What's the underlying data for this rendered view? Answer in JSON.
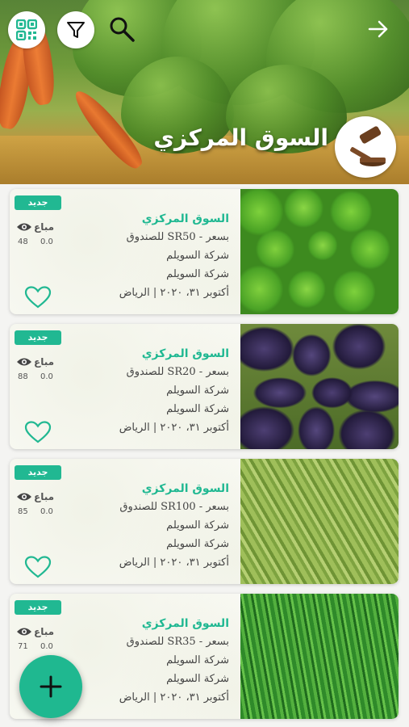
{
  "header": {
    "title": "السوق المركزي",
    "icons": [
      "qr-code-icon",
      "filter-icon",
      "search-icon",
      "arrow-right-icon",
      "auction-gavel-icon"
    ]
  },
  "colors": {
    "accent": "#21b892",
    "title_text": "#ffffff",
    "heart": "#21b892"
  },
  "listings": [
    {
      "badge": "جديد",
      "sold_label": "مباع",
      "views": "48",
      "sold_value": "0.0",
      "title": "السوق المركزي",
      "price_line": "بسعر - SR50 للصندوق",
      "company": "شركة السويلم",
      "seller": "شركة السويلم",
      "date_location": "أكتوبر ٣١، ٢٠٢٠ | الرياض",
      "image": "green-peppers"
    },
    {
      "badge": "جديد",
      "sold_label": "مباع",
      "views": "88",
      "sold_value": "0.0",
      "title": "السوق المركزي",
      "price_line": "بسعر - SR20 للصندوق",
      "company": "شركة السويلم",
      "seller": "شركة السويلم",
      "date_location": "أكتوبر ٣١، ٢٠٢٠ | الرياض",
      "image": "eggplants"
    },
    {
      "badge": "جديد",
      "sold_label": "مباع",
      "views": "85",
      "sold_value": "0.0",
      "title": "السوق المركزي",
      "price_line": "بسعر - SR100 للصندوق",
      "company": "شركة السويلم",
      "seller": "شركة السويلم",
      "date_location": "أكتوبر ٣١، ٢٠٢٠ | الرياض",
      "image": "okra"
    },
    {
      "badge": "جديد",
      "sold_label": "مباع",
      "views": "71",
      "sold_value": "0.0",
      "title": "السوق المركزي",
      "price_line": "بسعر - SR35 للصندوق",
      "company": "شركة السويلم",
      "seller": "شركة السويلم",
      "date_location": "أكتوبر ٣١، ٢٠٢٠ | الرياض",
      "image": "cucumbers"
    }
  ],
  "fab": {
    "icon": "plus-icon"
  }
}
